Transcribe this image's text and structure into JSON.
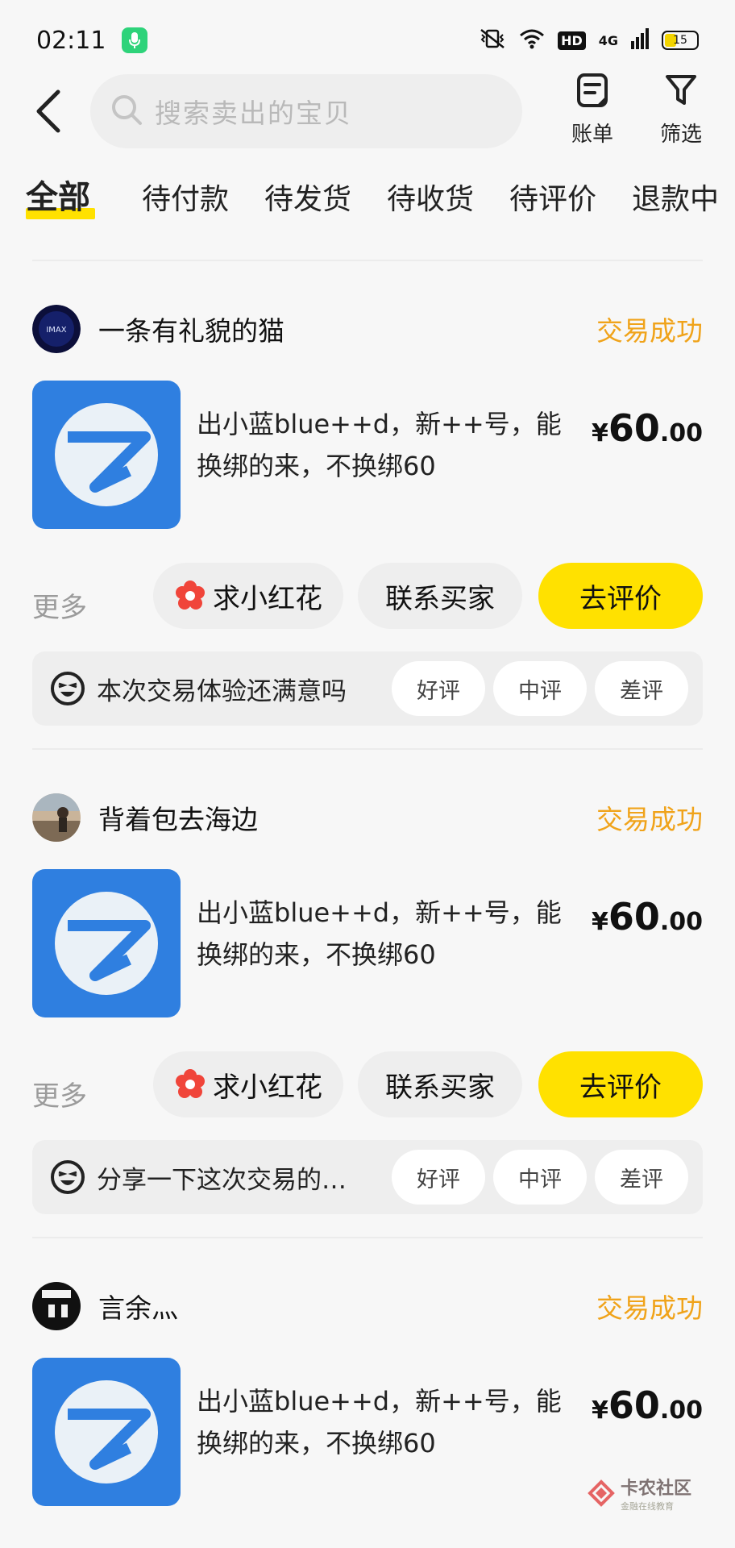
{
  "status_bar": {
    "time": "02:11",
    "network_label": "4G",
    "battery_level": "15"
  },
  "header": {
    "search_placeholder": "搜索卖出的宝贝",
    "bill_label": "账单",
    "filter_label": "筛选"
  },
  "tabs": [
    {
      "label": "全部",
      "active": true
    },
    {
      "label": "待付款",
      "active": false
    },
    {
      "label": "待发货",
      "active": false
    },
    {
      "label": "待收货",
      "active": false
    },
    {
      "label": "待评价",
      "active": false
    },
    {
      "label": "退款中",
      "active": false
    }
  ],
  "orders": [
    {
      "buyer": "一条有礼貌的猫",
      "avatar_text": "IMAX",
      "status": "交易成功",
      "title": "出小蓝blue++d，新++号，能换绑的来，不换绑60",
      "price_currency": "¥",
      "price_int": "60",
      "price_dec": ".00",
      "more_label": "更多",
      "flower_label": "求小红花",
      "contact_label": "联系买家",
      "review_label": "去评价",
      "review_question": "本次交易体验还满意吗",
      "rating": {
        "good": "好评",
        "mid": "中评",
        "bad": "差评"
      }
    },
    {
      "buyer": "背着包去海边",
      "status": "交易成功",
      "title": "出小蓝blue++d，新++号，能换绑的来，不换绑60",
      "price_currency": "¥",
      "price_int": "60",
      "price_dec": ".00",
      "more_label": "更多",
      "flower_label": "求小红花",
      "contact_label": "联系买家",
      "review_label": "去评价",
      "review_question": "分享一下这次交易的…",
      "rating": {
        "good": "好评",
        "mid": "中评",
        "bad": "差评"
      }
    },
    {
      "buyer": "言余灬",
      "status": "交易成功",
      "title": "出小蓝blue++d，新++号，能换绑的来，不换绑60",
      "price_currency": "¥",
      "price_int": "60",
      "price_dec": ".00"
    }
  ],
  "watermark": {
    "title": "卡农社区",
    "subtitle": "金融在线教育"
  },
  "colors": {
    "accent_yellow": "#ffe100",
    "status_orange": "#f0a31a",
    "flower_red": "#f0453a",
    "app_blue": "#2f7fe0"
  }
}
